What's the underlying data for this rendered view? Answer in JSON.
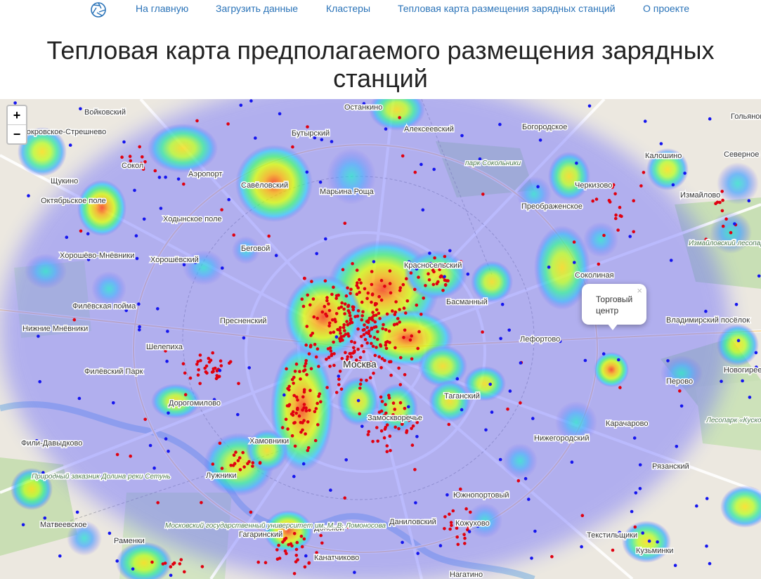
{
  "nav": {
    "logo_icon": "camera-aperture-icon",
    "items": [
      {
        "label": "На главную"
      },
      {
        "label": "Загрузить данные"
      },
      {
        "label": "Кластеры"
      },
      {
        "label": "Тепловая карта размещения зарядных станций"
      },
      {
        "label": "О проекте"
      }
    ]
  },
  "page": {
    "title_line1": "Тепловая карта предполагаемого размещения зарядных",
    "title_line2": "станций"
  },
  "map": {
    "zoom_in": "+",
    "zoom_out": "−",
    "popup_text": "Торговый центр",
    "popup_close": "×",
    "city_label": "Москва",
    "place_labels": [
      "Войковский",
      "Останкино",
      "Гольяново",
      "Покровское-Стрешнево",
      "Бутырский",
      "Алексеевский",
      "Богородское",
      "Сокол",
      "Аэропорт",
      "Савёловский",
      "Марьина Роща",
      "парк Сокольники",
      "Черкизово",
      "Калошино",
      "Северное Измайлово",
      "Щукино",
      "Октябрьское поле",
      "Ходынское поле",
      "Беговой",
      "Преображенское",
      "Измайлово",
      "Хорошёво-Мнёвники",
      "Хорошёвский",
      "Красносельский",
      "Соколиная",
      "Измайловский лесопарк",
      "Филёвская пойма",
      "Нижние Мнёвники",
      "Басманный",
      "Пресненский",
      "Шелепиха",
      "Лефортово",
      "Владимирский посёлок",
      "Филёвский Парк",
      "Новогиреево",
      "Дорогомилово",
      "Таганский",
      "Перово",
      "Замоскворечье",
      "Карачарово",
      "Фили-Давыдково",
      "Хамовники",
      "Нижегородский",
      "Лесопарк «Кусково»",
      "Рязанский",
      "Лужники",
      "Природный заказник Долина реки Сетунь",
      "Южнопортовый",
      "Матвеевское",
      "Донской",
      "Даниловский",
      "Кожухово",
      "Московский государственный университет им. М. В. Ломоносова",
      "Раменки",
      "Гагаринский",
      "Текстильщики",
      "Кузьминки",
      "Нагатино",
      "Канатчиково"
    ]
  }
}
